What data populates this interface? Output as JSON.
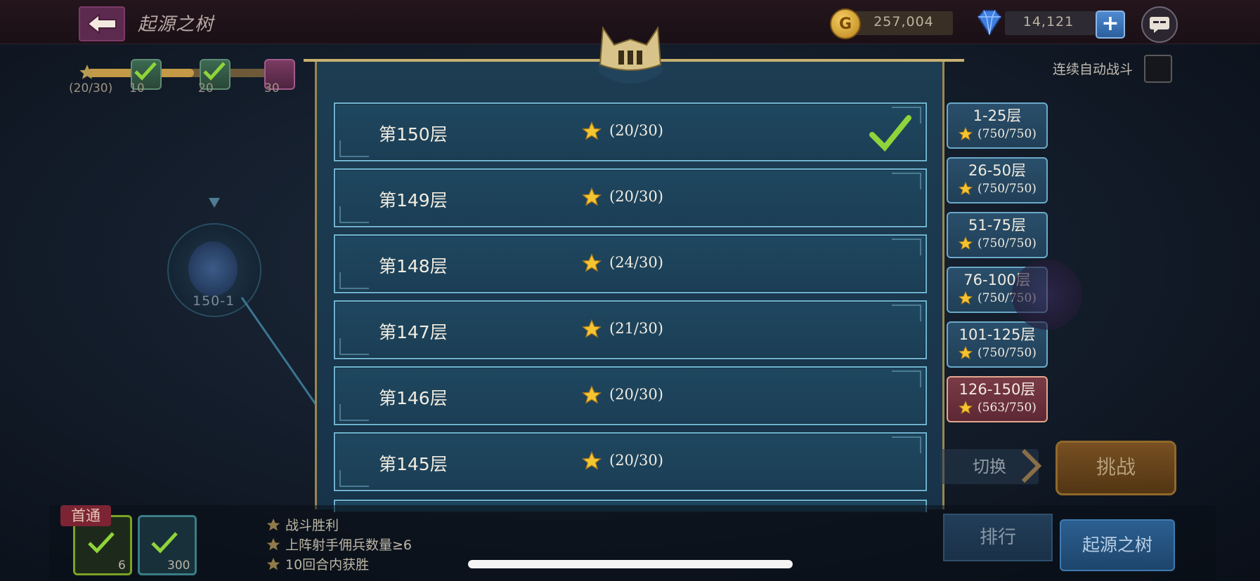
{
  "header": {
    "title": "起源之树",
    "gold": "257,004",
    "gems": "14,121"
  },
  "progress": {
    "stars_label": "(20/30)",
    "milestones": [
      "10",
      "20",
      "30"
    ]
  },
  "auto_battle": {
    "label": "连续自动战斗",
    "checked": false
  },
  "node": {
    "label": "150-1"
  },
  "floors": [
    {
      "name": "第150层",
      "stars": "(20/30)",
      "cleared": true
    },
    {
      "name": "第149层",
      "stars": "(20/30)",
      "cleared": false
    },
    {
      "name": "第148层",
      "stars": "(24/30)",
      "cleared": false
    },
    {
      "name": "第147层",
      "stars": "(21/30)",
      "cleared": false
    },
    {
      "name": "第146层",
      "stars": "(20/30)",
      "cleared": false
    },
    {
      "name": "第145层",
      "stars": "(20/30)",
      "cleared": false
    }
  ],
  "ranges": [
    {
      "label": "1-25层",
      "value": "(750/750)",
      "active": false
    },
    {
      "label": "26-50层",
      "value": "(750/750)",
      "active": false
    },
    {
      "label": "51-75层",
      "value": "(750/750)",
      "active": false
    },
    {
      "label": "76-100层",
      "value": "(750/750)",
      "active": false
    },
    {
      "label": "101-125层",
      "value": "(750/750)",
      "active": false
    },
    {
      "label": "126-150层",
      "value": "(563/750)",
      "active": true
    }
  ],
  "buttons": {
    "switch": "切换",
    "challenge": "挑战",
    "rank": "排行",
    "tree": "起源之树"
  },
  "bottom": {
    "badge": "首通",
    "slot1_count": "6",
    "slot2_count": "300",
    "objectives": [
      "战斗胜利",
      "上阵射手佣兵数量≥6",
      "10回合内获胜"
    ]
  },
  "colors": {
    "panel_border": "#6fb3cf",
    "active_tab": "#7a3b46",
    "star": "#f5c431",
    "check": "#8fd43a"
  }
}
